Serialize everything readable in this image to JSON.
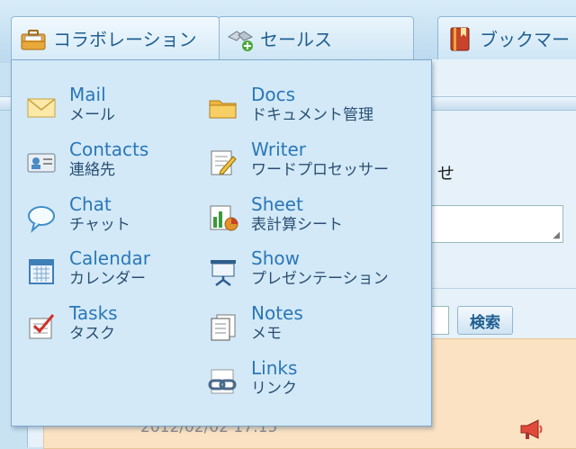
{
  "tabs": [
    {
      "label": "コラボレーション",
      "icon": "briefcase-icon"
    },
    {
      "label": "セールス",
      "icon": "handshake-icon"
    },
    {
      "label": "ブックマー",
      "icon": "bookmark-book-icon"
    }
  ],
  "menu": {
    "left": [
      {
        "en": "Mail",
        "jp": "メール",
        "icon": "envelope-icon"
      },
      {
        "en": "Contacts",
        "jp": "連絡先",
        "icon": "contact-card-icon"
      },
      {
        "en": "Chat",
        "jp": "チャット",
        "icon": "speech-bubble-icon"
      },
      {
        "en": "Calendar",
        "jp": "カレンダー",
        "icon": "calendar-icon"
      },
      {
        "en": "Tasks",
        "jp": "タスク",
        "icon": "checklist-icon"
      }
    ],
    "right": [
      {
        "en": "Docs",
        "jp": "ドキュメント管理",
        "icon": "folder-icon"
      },
      {
        "en": "Writer",
        "jp": "ワードプロセッサー",
        "icon": "document-edit-icon"
      },
      {
        "en": "Sheet",
        "jp": "表計算シート",
        "icon": "spreadsheet-icon"
      },
      {
        "en": "Show",
        "jp": "プレゼンテーション",
        "icon": "presentation-icon"
      },
      {
        "en": "Notes",
        "jp": "メモ",
        "icon": "notes-icon"
      },
      {
        "en": "Links",
        "jp": "リンク",
        "icon": "link-icon"
      }
    ]
  },
  "background": {
    "notice_fragment": "せ",
    "search_button": "検索",
    "date": "2012/02/02 17:15"
  },
  "colors": {
    "menu_bg": "#d3e9f7",
    "link_text": "#2a77b8",
    "background_panel": "#fbe2c2"
  }
}
